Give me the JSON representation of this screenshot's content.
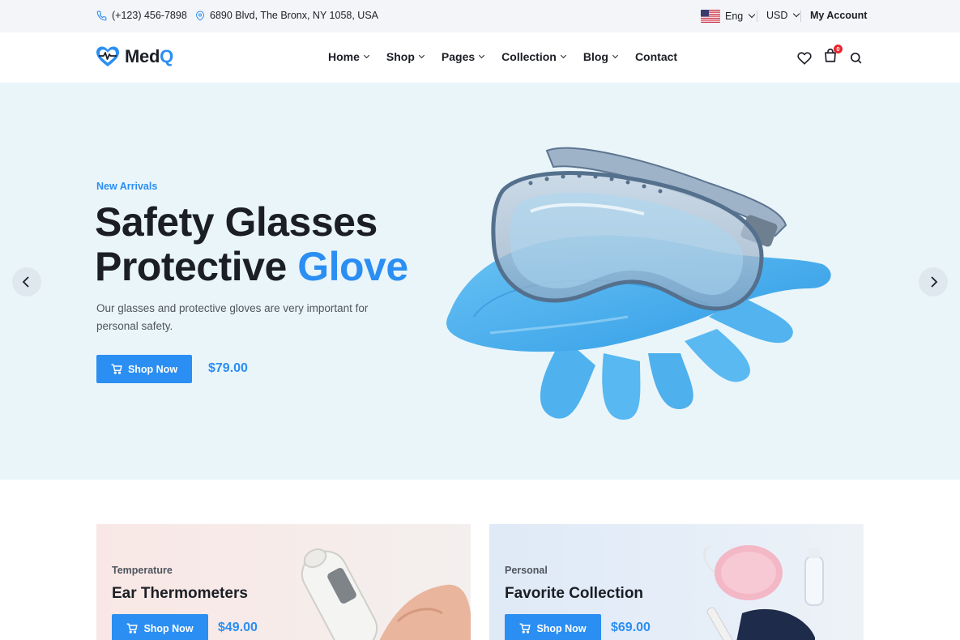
{
  "topbar": {
    "phone": "(+123) 456-7898",
    "address": "6890 Blvd, The Bronx, NY 1058, USA",
    "language": "Eng",
    "currency": "USD",
    "account": "My Account",
    "phone_icon": "phone-icon",
    "location_icon": "map-pin-icon"
  },
  "header": {
    "logo_main": "Med",
    "logo_accent": "Q",
    "nav": [
      {
        "label": "Home",
        "dropdown": true
      },
      {
        "label": "Shop",
        "dropdown": true
      },
      {
        "label": "Pages",
        "dropdown": true
      },
      {
        "label": "Collection",
        "dropdown": true
      },
      {
        "label": "Blog",
        "dropdown": true
      },
      {
        "label": "Contact",
        "dropdown": false
      }
    ],
    "cart_count": "0",
    "icons": [
      "heart-icon",
      "shopping-bag-icon",
      "search-icon"
    ]
  },
  "hero": {
    "eyebrow": "New Arrivals",
    "title_line1": "Safety Glasses",
    "title_line2_prefix": "Protective",
    "title_line2_accent": "Glove",
    "description": "Our glasses and protective gloves are very important for personal safety.",
    "button_label": "Shop Now",
    "price": "$79.00"
  },
  "banners": [
    {
      "category": "Temperature",
      "title": "Ear Thermometers",
      "button_label": "Shop Now",
      "price": "$49.00"
    },
    {
      "category": "Personal",
      "title": "Favorite Collection",
      "button_label": "Shop Now",
      "price": "$69.00"
    }
  ],
  "colors": {
    "accent": "#2b8ef2",
    "dark": "#1b1e25",
    "hero_bg": "#eaf5fa",
    "topbar_bg": "#f3f5f8",
    "badge": "#e8262d"
  }
}
